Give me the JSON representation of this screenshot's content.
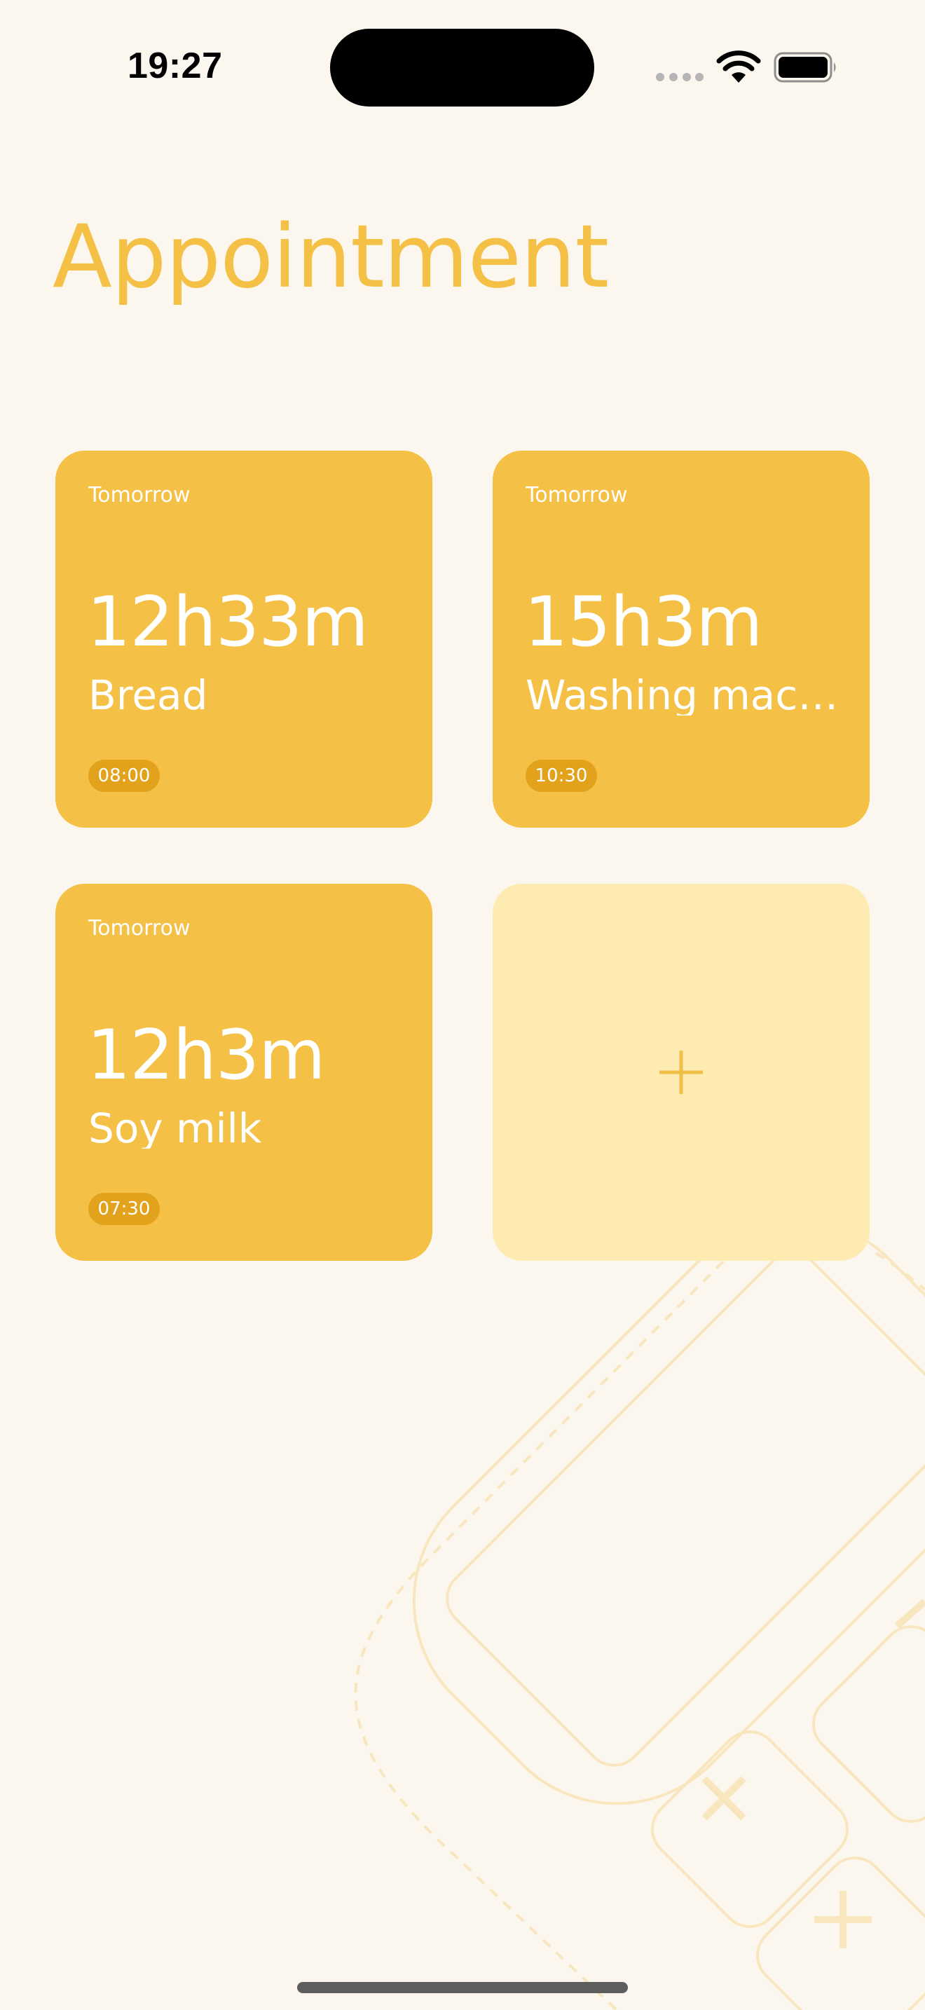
{
  "status_bar": {
    "time": "19:27"
  },
  "page": {
    "title": "Appointment"
  },
  "appointments": [
    {
      "day": "Tomorrow",
      "countdown": "12h33m",
      "name": "Bread",
      "time": "08:00"
    },
    {
      "day": "Tomorrow",
      "countdown": "15h3m",
      "name": "Washing mac…",
      "time": "10:30"
    },
    {
      "day": "Tomorrow",
      "countdown": "12h3m",
      "name": "Soy milk",
      "time": "07:30"
    }
  ],
  "colors": {
    "accent": "#F4C046",
    "time_badge": "#E3A21C",
    "add_card": "#FEEBB2",
    "background": "#FCF7EE"
  },
  "icons": {
    "add": "plus-icon",
    "wifi": "wifi-icon",
    "battery": "battery-icon"
  }
}
